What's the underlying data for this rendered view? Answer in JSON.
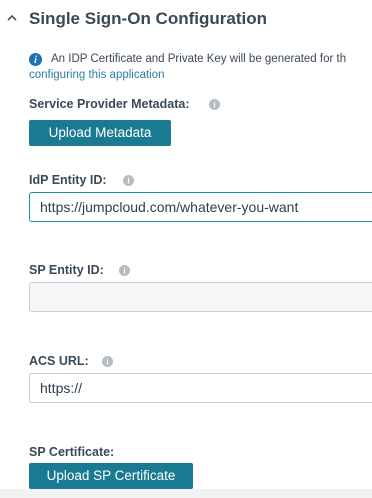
{
  "section": {
    "title": "Single Sign-On Configuration",
    "chevron_icon": "chevron-up-icon"
  },
  "info": {
    "icon": "info-icon",
    "text": "An IDP Certificate and Private Key will be generated for th",
    "link_text": "configuring this application"
  },
  "sp_metadata": {
    "label": "Service Provider Metadata:",
    "help_icon": "help-icon",
    "button_label": "Upload Metadata"
  },
  "idp_entity": {
    "label": "IdP Entity ID:",
    "help_icon": "help-icon",
    "value": "https://jumpcloud.com/whatever-you-want"
  },
  "sp_entity": {
    "label": "SP Entity ID:",
    "help_icon": "help-icon",
    "value": ""
  },
  "acs_url": {
    "label": "ACS URL:",
    "help_icon": "help-icon",
    "value": "https://"
  },
  "sp_certificate": {
    "label": "SP Certificate:",
    "button_label": "Upload SP Certificate"
  },
  "colors": {
    "accent": "#1a7a91",
    "link": "#2c7ea3",
    "info_icon": "#1f6fb4",
    "focus_border": "#1f8aa6",
    "text": "#3b4856"
  }
}
